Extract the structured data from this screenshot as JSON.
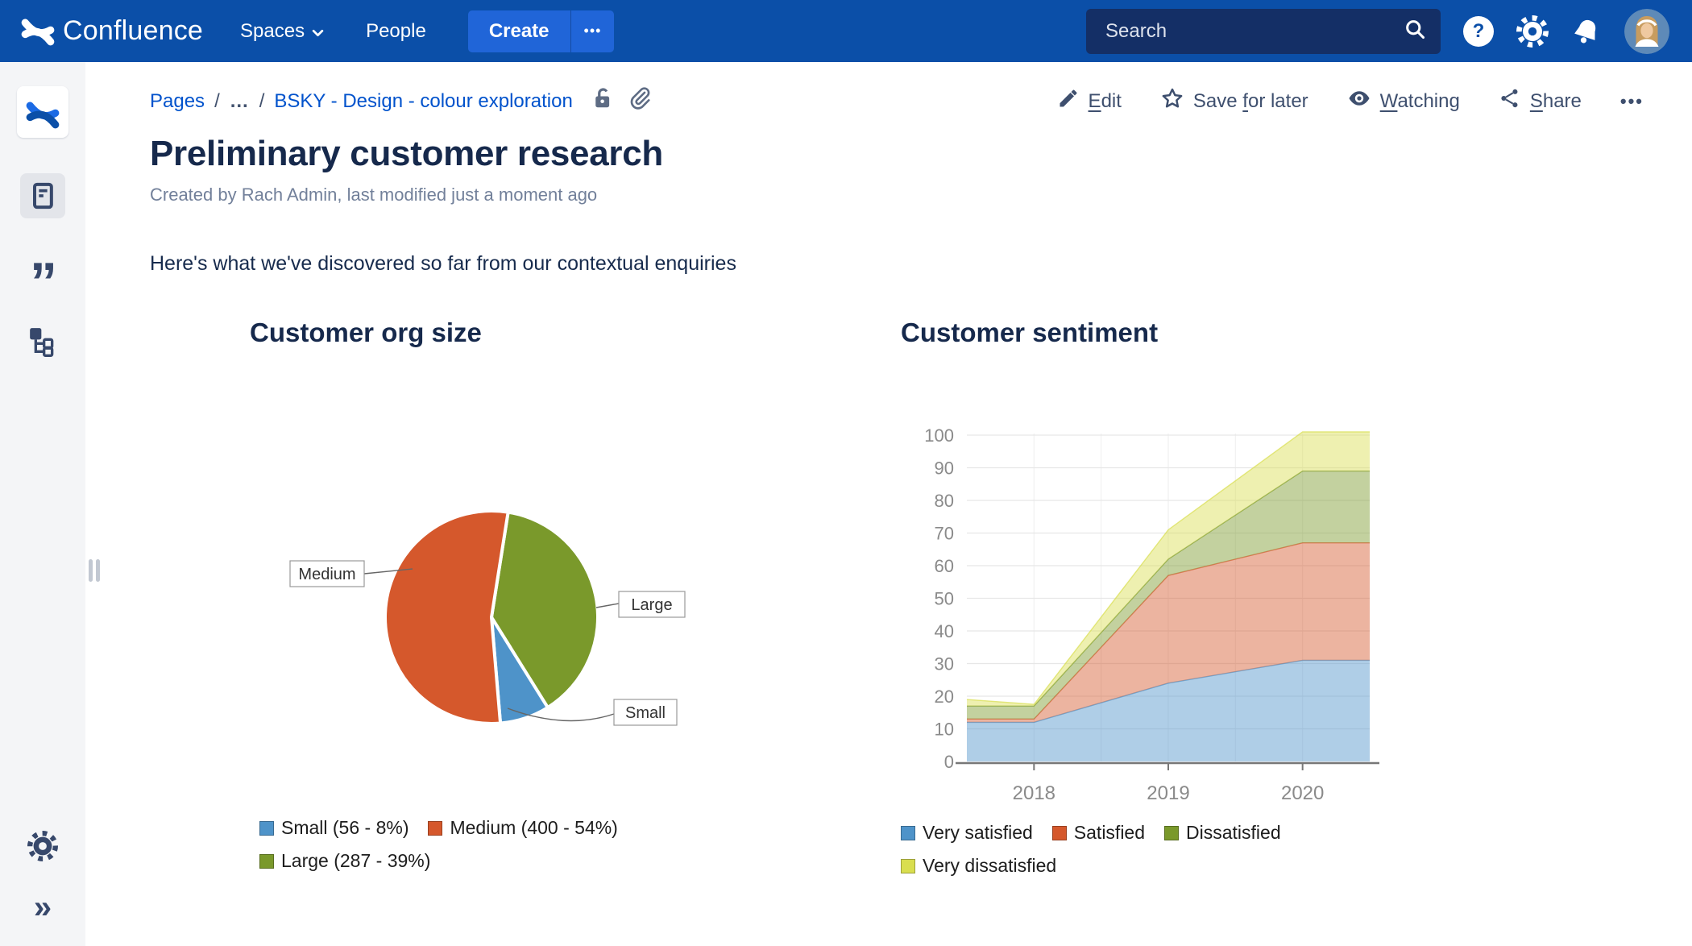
{
  "theme": {
    "navbar": "#0B4FA8",
    "create_button": "#2065D8",
    "link": "#0052CC",
    "heading_text": "#16294C",
    "body_text": "#172B4D",
    "muted_text": "#72809A",
    "action_text": "#3E4F6E",
    "sidebar_bg": "#F4F5F7",
    "sidebar_icon": "#37486B"
  },
  "nav": {
    "brand": "Confluence",
    "spaces_label": "Spaces",
    "people_label": "People",
    "create_label": "Create",
    "overflow_glyph": "•••",
    "search_placeholder": "Search",
    "help_glyph": "?",
    "icons": [
      "confluence-logo",
      "chevron-down-icon",
      "search-icon",
      "help-icon",
      "gear-icon",
      "bell-icon",
      "avatar"
    ]
  },
  "sidebar": {
    "icons": [
      "confluence-space-logo",
      "notes-icon",
      "quotes-icon",
      "page-tree-icon",
      "settings-gear-icon",
      "expand-chevrons-icon"
    ],
    "quotes_glyph": "”",
    "expand_glyph": "»"
  },
  "breadcrumb": {
    "root": "Pages",
    "sep": "/",
    "ellipsis": "…",
    "page": "BSKY - Design - colour exploration",
    "icons": [
      "unlocked-icon",
      "attachment-icon"
    ]
  },
  "actions": {
    "edit": {
      "pre": "",
      "key": "E",
      "post": "dit"
    },
    "save": {
      "pre": "Save ",
      "key": "f",
      "post": "or later"
    },
    "watching": {
      "pre": "",
      "key": "W",
      "post": "atching"
    },
    "share": {
      "pre": "",
      "key": "S",
      "post": "hare"
    },
    "overflow_glyph": "•••"
  },
  "page": {
    "title": "Preliminary customer research",
    "byline": "Created by Rach Admin, last modified just a moment ago",
    "intro": "Here's what we've discovered so far from our contextual enquiries"
  },
  "chart_data": [
    {
      "type": "pie",
      "title": "Customer org size",
      "labels": [
        "Small",
        "Medium",
        "Large"
      ],
      "values": [
        56,
        400,
        287
      ],
      "percents": [
        8,
        54,
        39
      ],
      "colors": {
        "Small": "#4E93C9",
        "Medium": "#D5582C",
        "Large": "#7A992B"
      },
      "legend": [
        "Small (56 - 8%)",
        "Medium (400 - 54%)",
        "Large (287 - 39%)"
      ],
      "callout_labels": [
        "Medium",
        "Large",
        "Small"
      ],
      "start_angle_deg": 9,
      "clockwise_order": [
        "Large",
        "Small",
        "Medium"
      ]
    },
    {
      "type": "area",
      "title": "Customer sentiment",
      "stacked": true,
      "x": [
        2017.5,
        2018,
        2019,
        2020,
        2020.5
      ],
      "x_ticks": [
        2018,
        2019,
        2020
      ],
      "ylim": [
        0,
        100
      ],
      "y_tick_step": 10,
      "grid": true,
      "legend_position": "bottom",
      "series": [
        {
          "name": "Very satisfied",
          "color": "#4E93C9",
          "values": [
            12,
            12,
            24,
            31,
            31
          ]
        },
        {
          "name": "Satisfied",
          "color": "#D5582C",
          "values": [
            1,
            1,
            33,
            36,
            36
          ]
        },
        {
          "name": "Dissatisfied",
          "color": "#7A992B",
          "values": [
            4,
            4,
            5,
            22,
            22
          ]
        },
        {
          "name": "Very dissatisfied",
          "color": "#D9DE4F",
          "values": [
            2,
            0.5,
            9,
            12,
            12
          ]
        }
      ]
    }
  ]
}
